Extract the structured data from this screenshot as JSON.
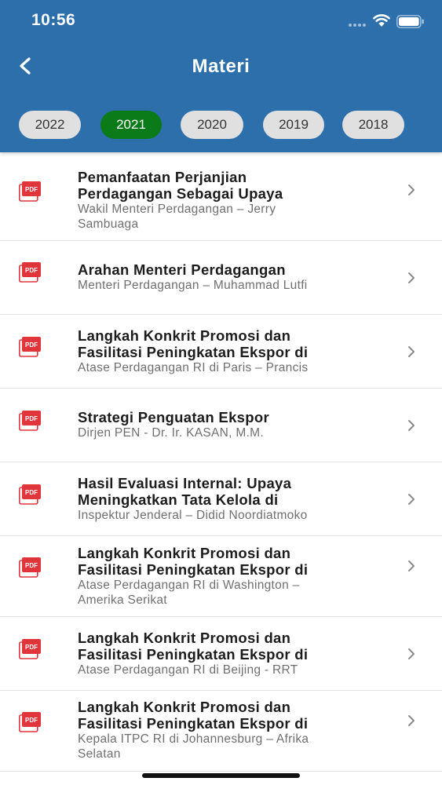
{
  "status_bar": {
    "time": "10:56"
  },
  "nav": {
    "title": "Materi"
  },
  "year_tabs": [
    {
      "label": "2022",
      "active": false
    },
    {
      "label": "2021",
      "active": true
    },
    {
      "label": "2020",
      "active": false
    },
    {
      "label": "2019",
      "active": false
    },
    {
      "label": "2018",
      "active": false
    }
  ],
  "items": [
    {
      "title_lines": [
        "Pemanfaatan Perjanjian",
        "Perdagangan Sebagai Upaya"
      ],
      "subtitle_lines": [
        "Wakil Menteri Perdagangan – Jerry",
        "Sambuaga"
      ]
    },
    {
      "title_lines": [
        "Arahan Menteri Perdagangan"
      ],
      "subtitle_lines": [
        "Menteri Perdagangan – Muhammad Lutfi"
      ]
    },
    {
      "title_lines": [
        "Langkah Konkrit Promosi dan",
        "Fasilitasi Peningkatan Ekspor di"
      ],
      "subtitle_lines": [
        "Atase Perdagangan RI di Paris – Prancis"
      ]
    },
    {
      "title_lines": [
        "Strategi Penguatan Ekspor"
      ],
      "subtitle_lines": [
        "Dirjen PEN - Dr. Ir. KASAN, M.M."
      ]
    },
    {
      "title_lines": [
        "Hasil Evaluasi Internal: Upaya",
        "Meningkatkan Tata Kelola di"
      ],
      "subtitle_lines": [
        "Inspektur Jenderal – Didid Noordiatmoko"
      ]
    },
    {
      "title_lines": [
        "Langkah Konkrit Promosi dan",
        "Fasilitasi Peningkatan Ekspor di"
      ],
      "subtitle_lines": [
        "Atase Perdagangan RI di Washington –",
        "Amerika Serikat"
      ]
    },
    {
      "title_lines": [
        "Langkah Konkrit Promosi dan",
        "Fasilitasi Peningkatan Ekspor di"
      ],
      "subtitle_lines": [
        "Atase Perdagangan RI di Beijing - RRT"
      ]
    },
    {
      "title_lines": [
        "Langkah Konkrit Promosi dan",
        "Fasilitasi Peningkatan Ekspor di"
      ],
      "subtitle_lines": [
        "Kepala ITPC RI di Johannesburg – Afrika",
        "Selatan"
      ]
    }
  ],
  "icons": {
    "back": "chevron-left-icon",
    "item": "pdf-file-icon",
    "row_action": "chevron-right-icon"
  },
  "colors": {
    "header": "#2c6fab",
    "active_tab": "#0b7a18",
    "pdf_icon": "#e0353b"
  }
}
